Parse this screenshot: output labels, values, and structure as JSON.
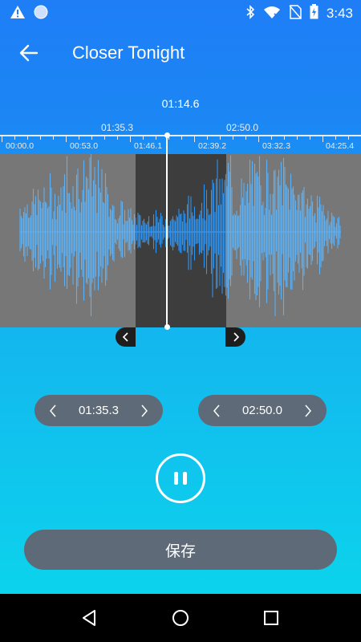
{
  "status_bar": {
    "time": "3:43",
    "icons": [
      "warning-icon",
      "circle-notification-icon",
      "bluetooth-icon",
      "wifi-off-icon",
      "no-sim-icon",
      "battery-charging-icon"
    ]
  },
  "header": {
    "title": "Closer Tonight",
    "back_icon": "arrow-left-icon"
  },
  "player": {
    "current_time": "01:14.6",
    "selection_start_label": "01:35.3",
    "selection_end_label": "02:50.0"
  },
  "ruler": {
    "labels": [
      "00:00.0",
      "00:53.0",
      "01:46.1",
      "02:39.2",
      "03:32.3",
      "04:25.4"
    ]
  },
  "controls": {
    "start_time": "01:35.3",
    "end_time": "02:50.0",
    "play_state": "pause-icon"
  },
  "save_label": "保存",
  "colors": {
    "gradient_top": "#1f7ef6",
    "gradient_bottom": "#0cd3ec",
    "wave_background": "#777777",
    "selection_background": "#3d3d3d",
    "wave_color": "#4aa8f2",
    "pill_background": "#5e6a77"
  },
  "nav": {
    "icons": [
      "back-triangle-icon",
      "home-circle-icon",
      "recents-square-icon"
    ]
  }
}
